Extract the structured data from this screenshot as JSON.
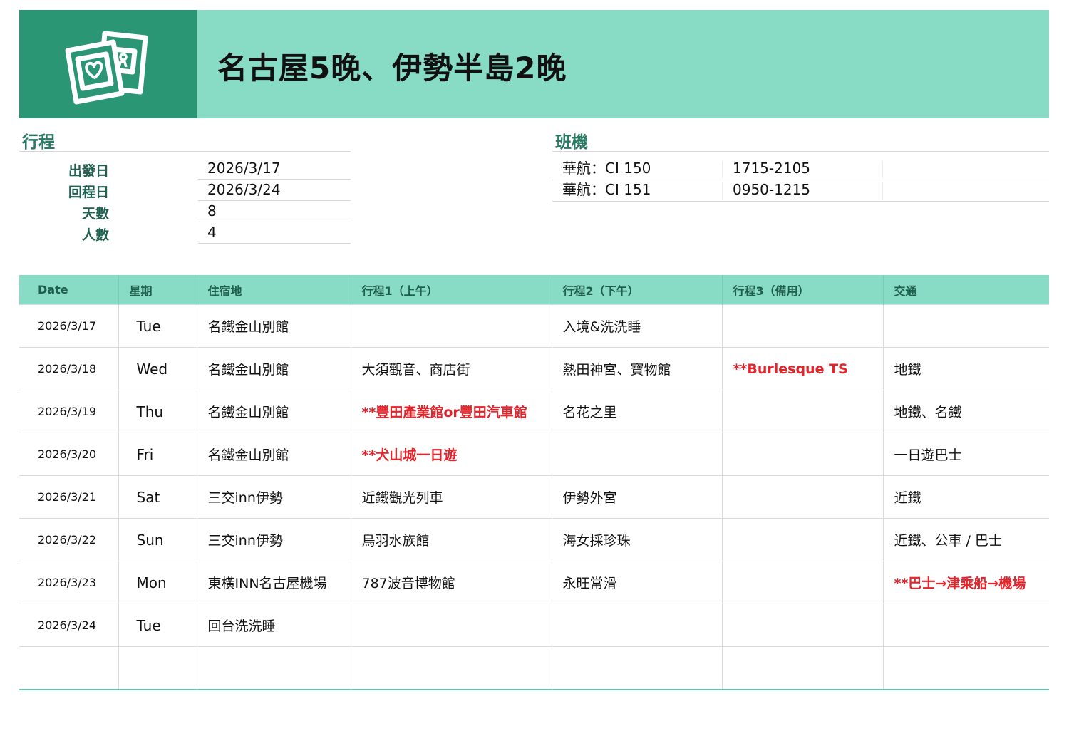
{
  "header": {
    "title": "名古屋5晚、伊勢半島2晚",
    "logo_icon": "photo-frames-icon",
    "accent_color": "#88dbc5",
    "dark_color": "#2a9673"
  },
  "trip": {
    "heading": "行程",
    "rows": [
      {
        "label": "出發日",
        "value": "2026/3/17"
      },
      {
        "label": "回程日",
        "value": "2026/3/24"
      },
      {
        "label": "天數",
        "value": "8"
      },
      {
        "label": "人數",
        "value": "4"
      }
    ]
  },
  "flights": {
    "heading": "班機",
    "rows": [
      {
        "flight": "華航：CI 150",
        "time": "1715-2105"
      },
      {
        "flight": "華航：CI 151",
        "time": "0950-1215"
      }
    ]
  },
  "itinerary": {
    "highlight_color": "#e3242b",
    "columns": [
      "Date",
      "星期",
      "住宿地",
      "行程1（上午）",
      "行程2（下午）",
      "行程3（備用）",
      "交通"
    ],
    "rows": [
      {
        "date": "2026/3/17",
        "day": "Tue",
        "stay": "名鐵金山別館",
        "am": "",
        "pm": "入境&洗洗睡",
        "alt": "",
        "transport": ""
      },
      {
        "date": "2026/3/18",
        "day": "Wed",
        "stay": "名鐵金山別館",
        "am": "大須觀音、商店街",
        "pm": "熱田神宮、寶物館",
        "alt": "**Burlesque TS",
        "transport": "地鐵"
      },
      {
        "date": "2026/3/19",
        "day": "Thu",
        "stay": "名鐵金山別館",
        "am": "**豐田產業館or豐田汽車館",
        "pm": "名花之里",
        "alt": "",
        "transport": "地鐵、名鐵"
      },
      {
        "date": "2026/3/20",
        "day": "Fri",
        "stay": "名鐵金山別館",
        "am": "**犬山城一日遊",
        "pm": "",
        "alt": "",
        "transport": "一日遊巴士"
      },
      {
        "date": "2026/3/21",
        "day": "Sat",
        "stay": "三交inn伊勢",
        "am": "近鐵觀光列車",
        "pm": "伊勢外宮",
        "alt": "",
        "transport": "近鐵"
      },
      {
        "date": "2026/3/22",
        "day": "Sun",
        "stay": "三交inn伊勢",
        "am": "鳥羽水族館",
        "pm": "海女採珍珠",
        "alt": "",
        "transport": "近鐵、公車 / 巴士"
      },
      {
        "date": "2026/3/23",
        "day": "Mon",
        "stay": "東橫INN名古屋機場",
        "am": "787波音博物館",
        "pm": "永旺常滑",
        "alt": "",
        "transport": "**巴士→津乘船→機場"
      },
      {
        "date": "2026/3/24",
        "day": "Tue",
        "stay": "回台洗洗睡",
        "am": "",
        "pm": "",
        "alt": "",
        "transport": ""
      },
      {
        "date": "",
        "day": "",
        "stay": "",
        "am": "",
        "pm": "",
        "alt": "",
        "transport": ""
      }
    ]
  }
}
